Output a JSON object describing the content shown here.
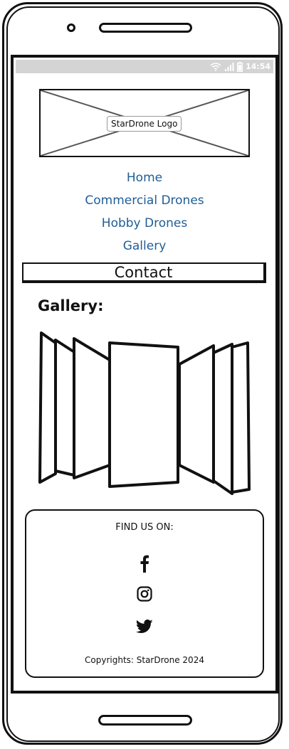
{
  "status_bar": {
    "time": "14:54"
  },
  "logo": {
    "label": "StarDrone Logo"
  },
  "nav": {
    "items": [
      {
        "label": "Home"
      },
      {
        "label": "Commercial Drones"
      },
      {
        "label": "Hobby Drones"
      },
      {
        "label": "Gallery"
      },
      {
        "label": "Contact"
      }
    ]
  },
  "gallery": {
    "heading": "Gallery:"
  },
  "footer": {
    "find_us": "FIND US ON:",
    "social_icons": [
      "facebook-icon",
      "instagram-icon",
      "twitter-icon"
    ],
    "copyright": "Copyrights: StarDrone 2024"
  },
  "colors": {
    "nav_link": "#1f5d96",
    "status_bar": "#d4d4d4",
    "ink": "#111111"
  }
}
